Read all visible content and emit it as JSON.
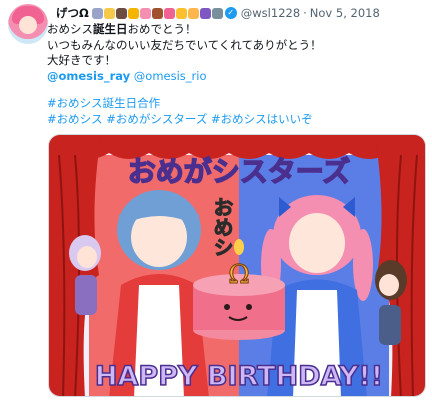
{
  "tweet": {
    "display_name": "げつΩ",
    "name_emojis": [
      {
        "icon": "rabbit-icon",
        "color": "#9aa3c8"
      },
      {
        "icon": "sparkle-icon",
        "color": "#f7c948"
      },
      {
        "icon": "boot-icon",
        "color": "#6d4c41"
      },
      {
        "icon": "balloon-icon",
        "color": "#f4b400"
      },
      {
        "icon": "flower-icon",
        "color": "#f48fb1"
      },
      {
        "icon": "squirrel-icon",
        "color": "#a0522d"
      },
      {
        "icon": "brain-icon",
        "color": "#f06292"
      },
      {
        "icon": "chick-icon",
        "color": "#fbc02d"
      },
      {
        "icon": "hand-icon",
        "color": "#ffb74d"
      },
      {
        "icon": "devil-icon",
        "color": "#7e57c2"
      },
      {
        "icon": "wolf-icon",
        "color": "#78909c"
      }
    ],
    "handle": "@wsl1228",
    "separator": "·",
    "date": "Nov 5, 2018",
    "text": {
      "line1_pre": "おめシス",
      "line1_bold": "誕生日",
      "line1_post": "おめでとう！",
      "line2": "いつもみんなのいい友だちでいてくれてありがとう！",
      "line3": "大好きです！",
      "mention1": "@omesis_ray",
      "mention2": "@omesis_rio",
      "hashtag1": "#おめシス誕生日合作",
      "hashtag2": "#おめシス",
      "hashtag3": "#おめがシスターズ",
      "hashtag4": "#おめシスはいいぞ"
    },
    "media": {
      "title_text": "おめがシスターズ",
      "vertical_text": "おめシ",
      "birthday_text": "HAPPY BIRTHDAY!!",
      "cake_symbol": "Ω",
      "colors": {
        "curtain": "#c8231e",
        "left_bg": "#f26b6b",
        "right_bg": "#5b7ee6",
        "cake": "#f06f8a",
        "text_fill": "#cdb8f5",
        "text_stroke": "#4b2f8f"
      }
    }
  }
}
